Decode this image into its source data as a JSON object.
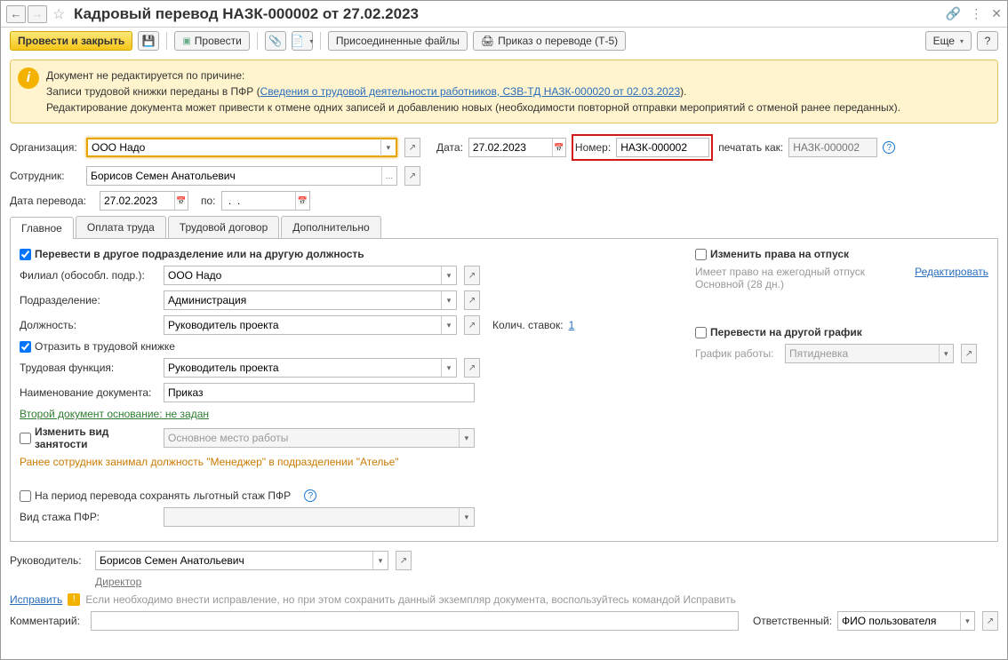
{
  "title": "Кадровый перевод НАЗК-000002 от 27.02.2023",
  "toolbar": {
    "post_close": "Провести и закрыть",
    "post": "Провести",
    "attached": "Присоединенные файлы",
    "order": "Приказ о переводе (Т-5)",
    "more": "Еще",
    "help": "?"
  },
  "notice": {
    "line1": "Документ не редактируется по причине:",
    "line2a": "Записи трудовой книжки переданы в ПФР (",
    "link": "Сведения о трудовой деятельности работников, СЗВ-ТД НАЗК-000020 от 02.03.2023",
    "line2b": ").",
    "line3": "Редактирование документа может привести к отмене одних записей и добавлению новых (необходимости повторной отправки мероприятий с отменой ранее переданных)."
  },
  "header": {
    "org_label": "Организация:",
    "org_value": "ООО Надо",
    "date_label": "Дата:",
    "date_value": "27.02.2023",
    "number_label": "Номер:",
    "number_value": "НАЗК-000002",
    "print_as_label": "печатать как:",
    "print_as_placeholder": "НАЗК-000002",
    "employee_label": "Сотрудник:",
    "employee_value": "Борисов Семен Анатольевич",
    "transfer_date_label": "Дата перевода:",
    "transfer_date_value": "27.02.2023",
    "to_label": "по:",
    "to_value": " .  ."
  },
  "tabs": [
    "Главное",
    "Оплата труда",
    "Трудовой договор",
    "Дополнительно"
  ],
  "main": {
    "chk_transfer_label": "Перевести в другое подразделение или на другую должность",
    "filial_label": "Филиал (обособл. подр.):",
    "filial_value": "ООО Надо",
    "dept_label": "Подразделение:",
    "dept_value": "Администрация",
    "position_label": "Должность:",
    "position_value": "Руководитель проекта",
    "rates_label": "Колич. ставок:",
    "rates_value": "1",
    "chk_workbook": "Отразить в трудовой книжке",
    "func_label": "Трудовая функция:",
    "func_value": "Руководитель проекта",
    "docname_label": "Наименование документа:",
    "docname_value": "Приказ",
    "second_doc_link": "Второй документ основание: не задан",
    "chk_change_employment": "Изменить вид занятости",
    "employment_value": "Основное место работы",
    "prev_note": "Ранее сотрудник занимал должность \"Менеджер\" в подразделении \"Ателье\"",
    "chk_keep_pfr": "На период перевода сохранять льготный стаж ПФР",
    "pfr_type_label": "Вид стажа ПФР:",
    "chk_vacation_rights": "Изменить права на отпуск",
    "vacation_text1": "Имеет право на ежегодный отпуск",
    "vacation_text2": "Основной (28 дн.)",
    "edit_link": "Редактировать",
    "chk_schedule": "Перевести на другой график",
    "schedule_label": "График работы:",
    "schedule_value": "Пятидневка"
  },
  "footer": {
    "head_label": "Руководитель:",
    "head_value": "Борисов Семен Анатольевич",
    "head_role": "Директор",
    "fix_link": "Исправить",
    "fix_note": "Если необходимо внести исправление, но при этом сохранить данный экземпляр документа, воспользуйтесь командой Исправить",
    "comment_label": "Комментарий:",
    "responsible_label": "Ответственный:",
    "responsible_value": "ФИО пользователя"
  }
}
